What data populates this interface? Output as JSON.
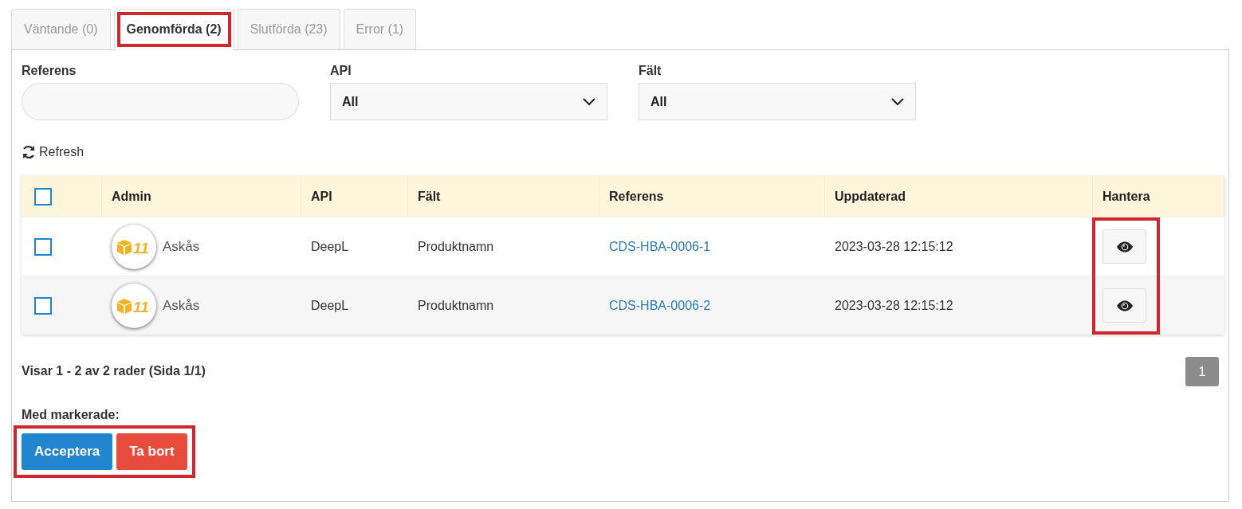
{
  "tabs": [
    {
      "label": "Väntande (0)",
      "selected": false,
      "highlighted": false
    },
    {
      "label": "Genomförda (2)",
      "selected": true,
      "highlighted": true
    },
    {
      "label": "Slutförda (23)",
      "selected": false,
      "highlighted": false
    },
    {
      "label": "Error (1)",
      "selected": false,
      "highlighted": false
    }
  ],
  "filters": [
    {
      "kind": "text",
      "label": "Referens"
    },
    {
      "kind": "select",
      "label": "API",
      "value": "All"
    },
    {
      "kind": "select",
      "label": "Fält",
      "value": "All"
    }
  ],
  "refresh": {
    "label": "Refresh"
  },
  "table": {
    "select_all_checked": false,
    "actions_highlighted": true,
    "columns": [
      "Admin",
      "API",
      "Fält",
      "Referens",
      "Uppdaterad",
      "Hantera"
    ],
    "rows": [
      {
        "checked": false,
        "avatar_text": "11",
        "admin": "Askås",
        "api": "DeepL",
        "field": "Produktnamn",
        "reference": "CDS-HBA-0006-1",
        "updated": "2023-03-28 12:15:12"
      },
      {
        "checked": false,
        "avatar_text": "11",
        "admin": "Askås",
        "api": "DeepL",
        "field": "Produktnamn",
        "reference": "CDS-HBA-0006-2",
        "updated": "2023-03-28 12:15:12"
      }
    ]
  },
  "summary": "Visar 1 - 2 av 2 rader (Sida 1/1)",
  "pagination": [
    {
      "label": "1",
      "selected": true
    }
  ],
  "bulk": {
    "label": "Med markerade:",
    "highlighted": true,
    "buttons": [
      {
        "kind": "primary",
        "label": "Acceptera"
      },
      {
        "kind": "danger",
        "label": "Ta bort"
      }
    ]
  }
}
